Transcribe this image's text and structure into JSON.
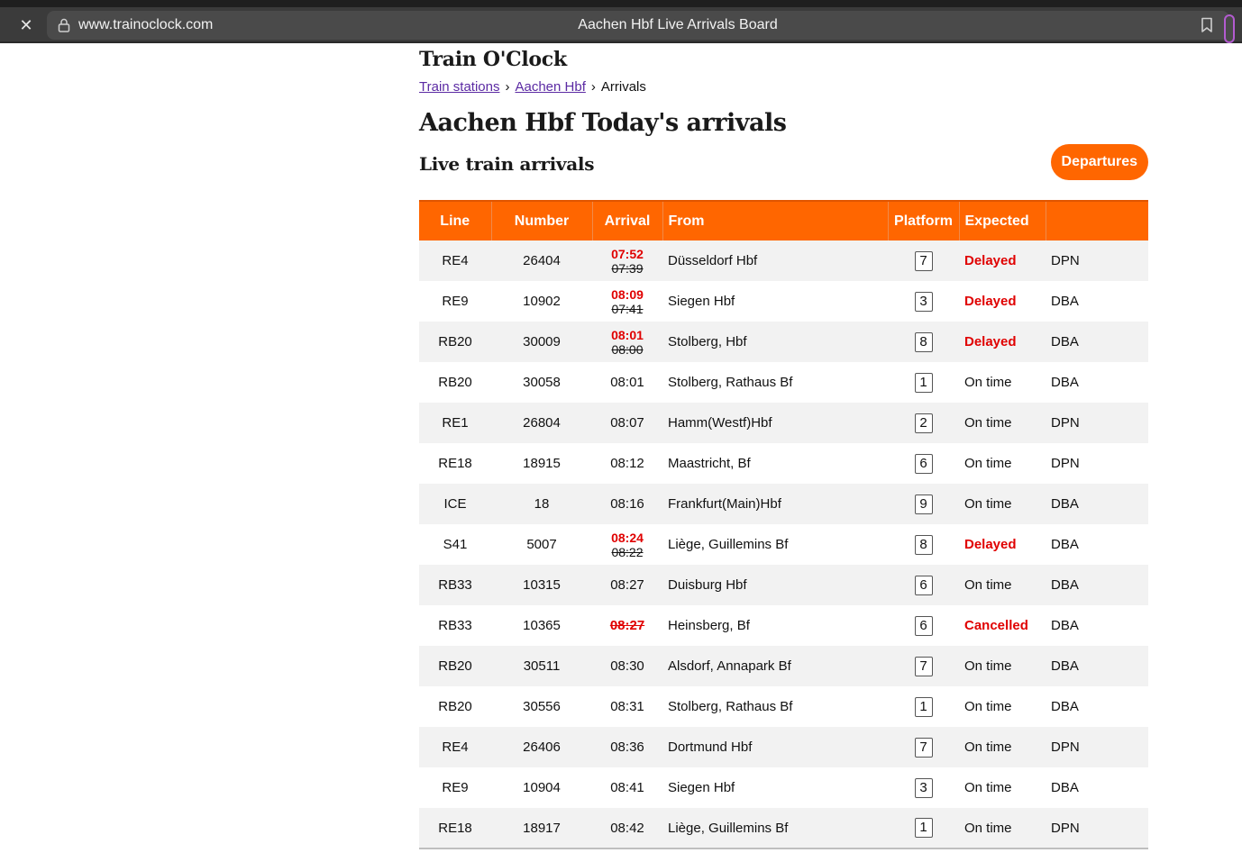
{
  "browser": {
    "url": "www.trainoclock.com",
    "tab_title": "Aachen Hbf Live Arrivals Board"
  },
  "site": {
    "name": "Train O'Clock"
  },
  "breadcrumb": {
    "items": [
      "Train stations",
      "Aachen Hbf",
      "Arrivals"
    ]
  },
  "page": {
    "heading": "Aachen Hbf Today's arrivals",
    "subheading": "Live train arrivals",
    "departures_button": "Departures"
  },
  "table": {
    "columns": [
      "Line",
      "Number",
      "Arrival",
      "From",
      "Platform",
      "Expected",
      ""
    ],
    "rows": [
      {
        "line": "RE4",
        "number": "26404",
        "arrival_new": "07:52",
        "arrival_old": "07:39",
        "from": "Düsseldorf Hbf",
        "platform": "7",
        "expected": "Delayed",
        "operator": "DPN"
      },
      {
        "line": "RE9",
        "number": "10902",
        "arrival_new": "08:09",
        "arrival_old": "07:41",
        "from": "Siegen Hbf",
        "platform": "3",
        "expected": "Delayed",
        "operator": "DBA"
      },
      {
        "line": "RB20",
        "number": "30009",
        "arrival_new": "08:01",
        "arrival_old": "08:00",
        "from": "Stolberg, Hbf",
        "platform": "8",
        "expected": "Delayed",
        "operator": "DBA"
      },
      {
        "line": "RB20",
        "number": "30058",
        "arrival": "08:01",
        "from": "Stolberg, Rathaus Bf",
        "platform": "1",
        "expected": "On time",
        "operator": "DBA"
      },
      {
        "line": "RE1",
        "number": "26804",
        "arrival": "08:07",
        "from": "Hamm(Westf)Hbf",
        "platform": "2",
        "expected": "On time",
        "operator": "DPN"
      },
      {
        "line": "RE18",
        "number": "18915",
        "arrival": "08:12",
        "from": "Maastricht, Bf",
        "platform": "6",
        "expected": "On time",
        "operator": "DPN"
      },
      {
        "line": "ICE",
        "number": "18",
        "arrival": "08:16",
        "from": "Frankfurt(Main)Hbf",
        "platform": "9",
        "expected": "On time",
        "operator": "DBA"
      },
      {
        "line": "S41",
        "number": "5007",
        "arrival_new": "08:24",
        "arrival_old": "08:22",
        "from": "Liège, Guillemins Bf",
        "platform": "8",
        "expected": "Delayed",
        "operator": "DBA"
      },
      {
        "line": "RB33",
        "number": "10315",
        "arrival": "08:27",
        "from": "Duisburg Hbf",
        "platform": "6",
        "expected": "On time",
        "operator": "DBA"
      },
      {
        "line": "RB33",
        "number": "10365",
        "arrival_cancelled": "08:27",
        "from": "Heinsberg, Bf",
        "platform": "6",
        "expected": "Cancelled",
        "operator": "DBA"
      },
      {
        "line": "RB20",
        "number": "30511",
        "arrival": "08:30",
        "from": "Alsdorf, Annapark Bf",
        "platform": "7",
        "expected": "On time",
        "operator": "DBA"
      },
      {
        "line": "RB20",
        "number": "30556",
        "arrival": "08:31",
        "from": "Stolberg, Rathaus Bf",
        "platform": "1",
        "expected": "On time",
        "operator": "DBA"
      },
      {
        "line": "RE4",
        "number": "26406",
        "arrival": "08:36",
        "from": "Dortmund Hbf",
        "platform": "7",
        "expected": "On time",
        "operator": "DPN"
      },
      {
        "line": "RE9",
        "number": "10904",
        "arrival": "08:41",
        "from": "Siegen Hbf",
        "platform": "3",
        "expected": "On time",
        "operator": "DBA"
      },
      {
        "line": "RE18",
        "number": "18917",
        "arrival": "08:42",
        "from": "Liège, Guillemins Bf",
        "platform": "1",
        "expected": "On time",
        "operator": "DPN"
      }
    ]
  },
  "colors": {
    "accent": "#ff6600",
    "alert": "#e00000",
    "link": "#5b2aa3"
  }
}
